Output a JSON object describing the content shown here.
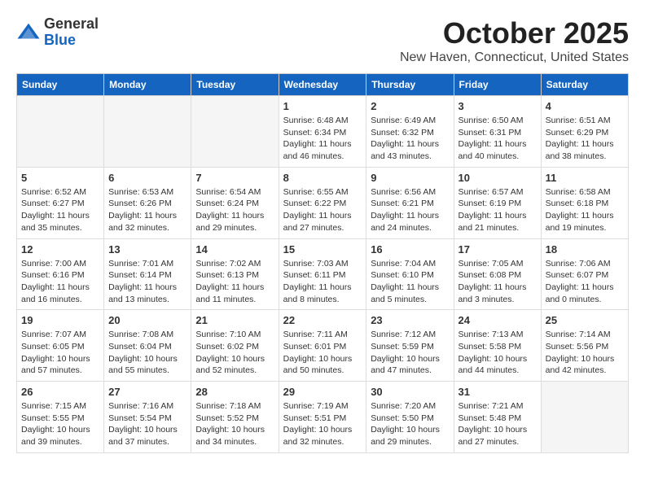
{
  "logo": {
    "general": "General",
    "blue": "Blue"
  },
  "title": {
    "month": "October 2025",
    "location": "New Haven, Connecticut, United States"
  },
  "days_of_week": [
    "Sunday",
    "Monday",
    "Tuesday",
    "Wednesday",
    "Thursday",
    "Friday",
    "Saturday"
  ],
  "weeks": [
    [
      {
        "day": "",
        "info": ""
      },
      {
        "day": "",
        "info": ""
      },
      {
        "day": "",
        "info": ""
      },
      {
        "day": "1",
        "info": "Sunrise: 6:48 AM\nSunset: 6:34 PM\nDaylight: 11 hours and 46 minutes."
      },
      {
        "day": "2",
        "info": "Sunrise: 6:49 AM\nSunset: 6:32 PM\nDaylight: 11 hours and 43 minutes."
      },
      {
        "day": "3",
        "info": "Sunrise: 6:50 AM\nSunset: 6:31 PM\nDaylight: 11 hours and 40 minutes."
      },
      {
        "day": "4",
        "info": "Sunrise: 6:51 AM\nSunset: 6:29 PM\nDaylight: 11 hours and 38 minutes."
      }
    ],
    [
      {
        "day": "5",
        "info": "Sunrise: 6:52 AM\nSunset: 6:27 PM\nDaylight: 11 hours and 35 minutes."
      },
      {
        "day": "6",
        "info": "Sunrise: 6:53 AM\nSunset: 6:26 PM\nDaylight: 11 hours and 32 minutes."
      },
      {
        "day": "7",
        "info": "Sunrise: 6:54 AM\nSunset: 6:24 PM\nDaylight: 11 hours and 29 minutes."
      },
      {
        "day": "8",
        "info": "Sunrise: 6:55 AM\nSunset: 6:22 PM\nDaylight: 11 hours and 27 minutes."
      },
      {
        "day": "9",
        "info": "Sunrise: 6:56 AM\nSunset: 6:21 PM\nDaylight: 11 hours and 24 minutes."
      },
      {
        "day": "10",
        "info": "Sunrise: 6:57 AM\nSunset: 6:19 PM\nDaylight: 11 hours and 21 minutes."
      },
      {
        "day": "11",
        "info": "Sunrise: 6:58 AM\nSunset: 6:18 PM\nDaylight: 11 hours and 19 minutes."
      }
    ],
    [
      {
        "day": "12",
        "info": "Sunrise: 7:00 AM\nSunset: 6:16 PM\nDaylight: 11 hours and 16 minutes."
      },
      {
        "day": "13",
        "info": "Sunrise: 7:01 AM\nSunset: 6:14 PM\nDaylight: 11 hours and 13 minutes."
      },
      {
        "day": "14",
        "info": "Sunrise: 7:02 AM\nSunset: 6:13 PM\nDaylight: 11 hours and 11 minutes."
      },
      {
        "day": "15",
        "info": "Sunrise: 7:03 AM\nSunset: 6:11 PM\nDaylight: 11 hours and 8 minutes."
      },
      {
        "day": "16",
        "info": "Sunrise: 7:04 AM\nSunset: 6:10 PM\nDaylight: 11 hours and 5 minutes."
      },
      {
        "day": "17",
        "info": "Sunrise: 7:05 AM\nSunset: 6:08 PM\nDaylight: 11 hours and 3 minutes."
      },
      {
        "day": "18",
        "info": "Sunrise: 7:06 AM\nSunset: 6:07 PM\nDaylight: 11 hours and 0 minutes."
      }
    ],
    [
      {
        "day": "19",
        "info": "Sunrise: 7:07 AM\nSunset: 6:05 PM\nDaylight: 10 hours and 57 minutes."
      },
      {
        "day": "20",
        "info": "Sunrise: 7:08 AM\nSunset: 6:04 PM\nDaylight: 10 hours and 55 minutes."
      },
      {
        "day": "21",
        "info": "Sunrise: 7:10 AM\nSunset: 6:02 PM\nDaylight: 10 hours and 52 minutes."
      },
      {
        "day": "22",
        "info": "Sunrise: 7:11 AM\nSunset: 6:01 PM\nDaylight: 10 hours and 50 minutes."
      },
      {
        "day": "23",
        "info": "Sunrise: 7:12 AM\nSunset: 5:59 PM\nDaylight: 10 hours and 47 minutes."
      },
      {
        "day": "24",
        "info": "Sunrise: 7:13 AM\nSunset: 5:58 PM\nDaylight: 10 hours and 44 minutes."
      },
      {
        "day": "25",
        "info": "Sunrise: 7:14 AM\nSunset: 5:56 PM\nDaylight: 10 hours and 42 minutes."
      }
    ],
    [
      {
        "day": "26",
        "info": "Sunrise: 7:15 AM\nSunset: 5:55 PM\nDaylight: 10 hours and 39 minutes."
      },
      {
        "day": "27",
        "info": "Sunrise: 7:16 AM\nSunset: 5:54 PM\nDaylight: 10 hours and 37 minutes."
      },
      {
        "day": "28",
        "info": "Sunrise: 7:18 AM\nSunset: 5:52 PM\nDaylight: 10 hours and 34 minutes."
      },
      {
        "day": "29",
        "info": "Sunrise: 7:19 AM\nSunset: 5:51 PM\nDaylight: 10 hours and 32 minutes."
      },
      {
        "day": "30",
        "info": "Sunrise: 7:20 AM\nSunset: 5:50 PM\nDaylight: 10 hours and 29 minutes."
      },
      {
        "day": "31",
        "info": "Sunrise: 7:21 AM\nSunset: 5:48 PM\nDaylight: 10 hours and 27 minutes."
      },
      {
        "day": "",
        "info": ""
      }
    ]
  ]
}
